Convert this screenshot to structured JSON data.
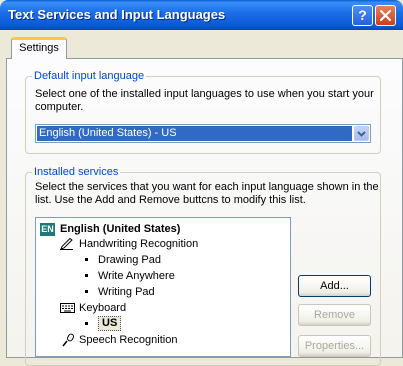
{
  "window": {
    "title": "Text Services and Input Languages",
    "help_label": "?"
  },
  "tabs": [
    {
      "label": "Settings"
    }
  ],
  "default_language": {
    "legend": "Default input language",
    "description_line1": "Select one of the installed input languages to use when you start your",
    "description_line2": "computer.",
    "selected": "English (United States) - US"
  },
  "installed_services": {
    "legend": "Installed services",
    "description_line1": "Select the services that you want for each input language shown in the",
    "description_line2": "list. Use the Add and Remove buttcns to modify this list.",
    "tree": {
      "language_badge": "EN",
      "language": "English (United States)",
      "handwriting": "Handwriting Recognition",
      "handwriting_items": [
        "Drawing Pad",
        "Write Anywhere",
        "Writing Pad"
      ],
      "keyboard": "Keyboard",
      "keyboard_item": "US",
      "speech": "Speech Recognition"
    }
  },
  "buttons": {
    "add": "Add...",
    "remove": "Remove",
    "properties": "Properties..."
  },
  "icons": [
    "help-icon",
    "close-icon",
    "dropdown-arrow-icon",
    "language-badge-icon",
    "pen-icon",
    "keyboard-icon",
    "microphone-icon"
  ]
}
